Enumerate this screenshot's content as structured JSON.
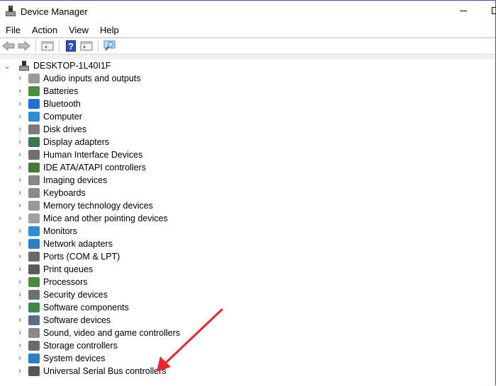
{
  "window": {
    "title": "Device Manager"
  },
  "menu": [
    "File",
    "Action",
    "View",
    "Help"
  ],
  "toolbar": [
    "back-icon",
    "forward-icon",
    "show-hide-console-tree-icon",
    "help-icon",
    "properties-icon",
    "scan-hardware-icon"
  ],
  "tree": {
    "root": "DESKTOP-1L40I1F",
    "items": [
      {
        "label": "Audio inputs and outputs",
        "color": "#9a9a9a"
      },
      {
        "label": "Batteries",
        "color": "#4a8f3a"
      },
      {
        "label": "Bluetooth",
        "color": "#1e6fd9"
      },
      {
        "label": "Computer",
        "color": "#2b8fd6"
      },
      {
        "label": "Disk drives",
        "color": "#7a7a7a"
      },
      {
        "label": "Display adapters",
        "color": "#3a7a4a"
      },
      {
        "label": "Human Interface Devices",
        "color": "#707070"
      },
      {
        "label": "IDE ATA/ATAPI controllers",
        "color": "#4a7a3a"
      },
      {
        "label": "Imaging devices",
        "color": "#888888"
      },
      {
        "label": "Keyboards",
        "color": "#8a8a8a"
      },
      {
        "label": "Memory technology devices",
        "color": "#9a9a9a"
      },
      {
        "label": "Mice and other pointing devices",
        "color": "#a0a0a0"
      },
      {
        "label": "Monitors",
        "color": "#2b8fd6"
      },
      {
        "label": "Network adapters",
        "color": "#2b7fc6"
      },
      {
        "label": "Ports (COM & LPT)",
        "color": "#6a6a6a"
      },
      {
        "label": "Print queues",
        "color": "#5a5a5a"
      },
      {
        "label": "Processors",
        "color": "#4a8a3a"
      },
      {
        "label": "Security devices",
        "color": "#707070"
      },
      {
        "label": "Software components",
        "color": "#3a8a4a"
      },
      {
        "label": "Software devices",
        "color": "#5a6a8a"
      },
      {
        "label": "Sound, video and game controllers",
        "color": "#8a8a8a"
      },
      {
        "label": "Storage controllers",
        "color": "#6a6a6a"
      },
      {
        "label": "System devices",
        "color": "#2b7fc6"
      },
      {
        "label": "Universal Serial Bus controllers",
        "color": "#555555"
      }
    ]
  },
  "annotation": {
    "arrow_color": "#e8262b"
  }
}
